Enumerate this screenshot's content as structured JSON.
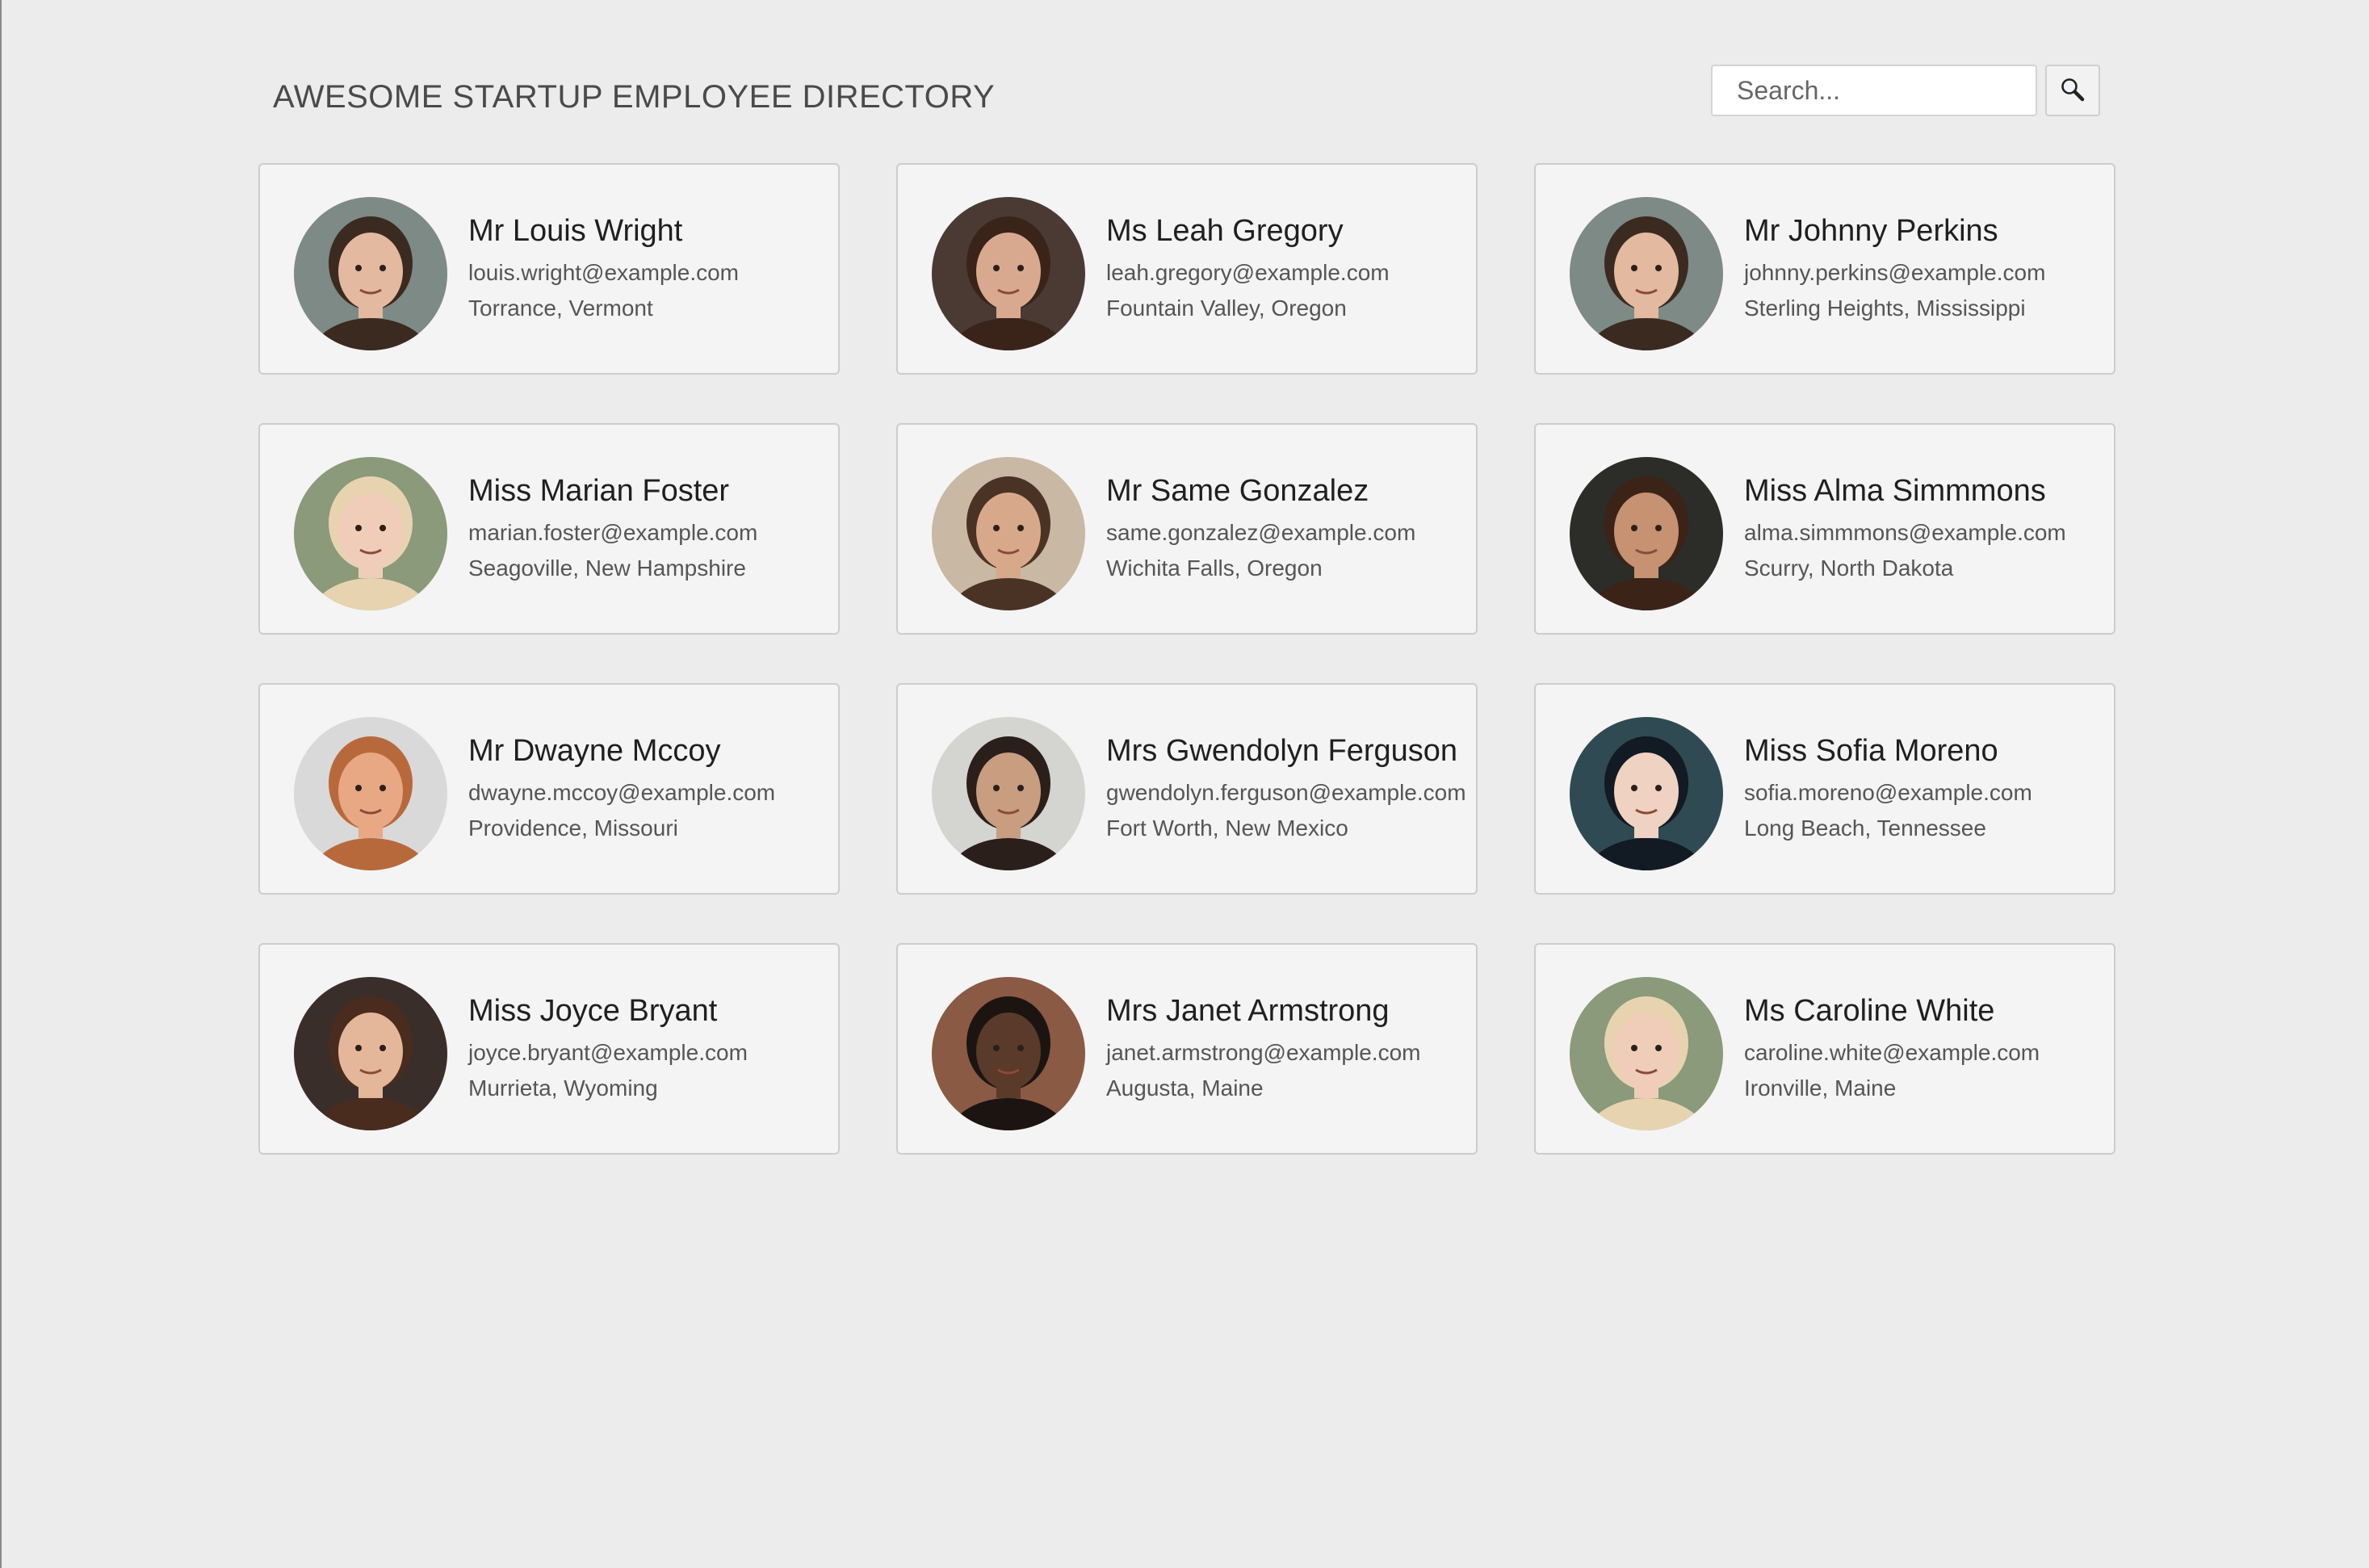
{
  "header": {
    "title": "AWESOME STARTUP EMPLOYEE DIRECTORY",
    "search_placeholder": "Search..."
  },
  "icons": {
    "search_button": "magnifying-glass-icon"
  },
  "employees": [
    {
      "name": "Mr Louis Wright",
      "email": "louis.wright@example.com",
      "location": "Torrance, Vermont",
      "avatar": {
        "bg": "#7d8a86",
        "skin": "#e3b9a0",
        "hair": "#3b2a20"
      }
    },
    {
      "name": "Ms Leah Gregory",
      "email": "leah.gregory@example.com",
      "location": "Fountain Valley, Oregon",
      "avatar": {
        "bg": "#4b3a33",
        "skin": "#d9a98f",
        "hair": "#3a2419"
      }
    },
    {
      "name": "Mr Johnny Perkins",
      "email": "johnny.perkins@example.com",
      "location": "Sterling Heights, Mississippi",
      "avatar": {
        "bg": "#7d8a86",
        "skin": "#e3b9a0",
        "hair": "#3b2a20"
      }
    },
    {
      "name": "Miss Marian Foster",
      "email": "marian.foster@example.com",
      "location": "Seagoville, New Hampshire",
      "avatar": {
        "bg": "#8a9a7a",
        "skin": "#f0cdb8",
        "hair": "#e8d3b0"
      }
    },
    {
      "name": "Mr Same Gonzalez",
      "email": "same.gonzalez@example.com",
      "location": "Wichita Falls, Oregon",
      "avatar": {
        "bg": "#c8b8a4",
        "skin": "#d7a98a",
        "hair": "#4a3324"
      }
    },
    {
      "name": "Miss Alma Simmmons",
      "email": "alma.simmmons@example.com",
      "location": "Scurry, North Dakota",
      "avatar": {
        "bg": "#2c2c28",
        "skin": "#c69272",
        "hair": "#3b2318"
      }
    },
    {
      "name": "Mr Dwayne Mccoy",
      "email": "dwayne.mccoy@example.com",
      "location": "Providence, Missouri",
      "avatar": {
        "bg": "#d9d9d9",
        "skin": "#e8a884",
        "hair": "#b8693c"
      }
    },
    {
      "name": "Mrs Gwendolyn Ferguson",
      "email": "gwendolyn.ferguson@example.com",
      "location": "Fort Worth, New Mexico",
      "avatar": {
        "bg": "#d4d4d0",
        "skin": "#c89d80",
        "hair": "#2a1f1a"
      }
    },
    {
      "name": "Miss Sofia Moreno",
      "email": "sofia.moreno@example.com",
      "location": "Long Beach, Tennessee",
      "avatar": {
        "bg": "#2f4a52",
        "skin": "#f0d2c2",
        "hair": "#121a24"
      }
    },
    {
      "name": "Miss Joyce Bryant",
      "email": "joyce.bryant@example.com",
      "location": "Murrieta, Wyoming",
      "avatar": {
        "bg": "#3a2e2a",
        "skin": "#e5b79a",
        "hair": "#4a2c1e"
      }
    },
    {
      "name": "Mrs Janet Armstrong",
      "email": "janet.armstrong@example.com",
      "location": "Augusta, Maine",
      "avatar": {
        "bg": "#8b5a44",
        "skin": "#5a3a2a",
        "hair": "#1c1410"
      }
    },
    {
      "name": "Ms Caroline White",
      "email": "caroline.white@example.com",
      "location": "Ironville, Maine",
      "avatar": {
        "bg": "#8a9a7a",
        "skin": "#f0cdb8",
        "hair": "#e8d3b0"
      }
    }
  ]
}
